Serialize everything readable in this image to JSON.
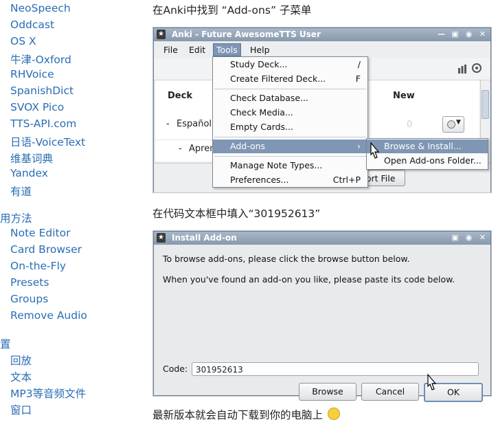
{
  "sidebar": {
    "links_top": [
      "NeoSpeech",
      "Oddcast",
      "OS X",
      "牛津-Oxford",
      "RHVoice",
      "SpanishDict",
      "SVOX Pico",
      "TTS-API.com",
      "日语-VoiceText",
      "维基词典",
      "Yandex",
      "有道"
    ],
    "section_usage": "用方法",
    "links_usage": [
      "Note Editor",
      "Card Browser",
      "On-the-Fly",
      "Presets",
      "Groups",
      "Remove Audio"
    ],
    "section_settings": "置",
    "links_settings": [
      "回放",
      "文本",
      "MP3等音频文件",
      "窗口"
    ]
  },
  "article": {
    "para1": "在Anki中找到 “Add-ons” 子菜单",
    "para2": "在代码文本框中填入“301952613”",
    "para3": "最新版本就会自动下载到你的电脑上"
  },
  "anki_window": {
    "title": "Anki - Future AwesomeTTS User",
    "menus": [
      "File",
      "Edit",
      "Tools",
      "Help"
    ],
    "deck_header": "Deck",
    "new_header": "New",
    "decks": [
      "Español",
      "Apren"
    ],
    "new_count": "0",
    "import_button": "nport File",
    "tools_menu": [
      {
        "label": "Study Deck...",
        "shortcut": "/"
      },
      {
        "label": "Create Filtered Deck...",
        "shortcut": "F"
      },
      {
        "label": "Check Database...",
        "shortcut": ""
      },
      {
        "label": "Check Media...",
        "shortcut": ""
      },
      {
        "label": "Empty Cards...",
        "shortcut": ""
      },
      {
        "label": "Add-ons",
        "shortcut": "›"
      },
      {
        "label": "Manage Note Types...",
        "shortcut": ""
      },
      {
        "label": "Preferences...",
        "shortcut": "Ctrl+P"
      }
    ],
    "addons_submenu": [
      "Browse & Install...",
      "Open Add-ons Folder..."
    ]
  },
  "install_window": {
    "title": "Install Add-on",
    "line1": "To browse add-ons, please click the browse button below.",
    "line2": "When you've found an add-on you like, please paste its code below.",
    "code_label": "Code:",
    "code_value": "301952613",
    "browse_button": "Browse",
    "cancel_button": "Cancel",
    "ok_button": "OK"
  },
  "colors": {
    "link": "#2a6db5",
    "highlight": "#7f96b4",
    "titlebar": "#8ea0b5"
  }
}
